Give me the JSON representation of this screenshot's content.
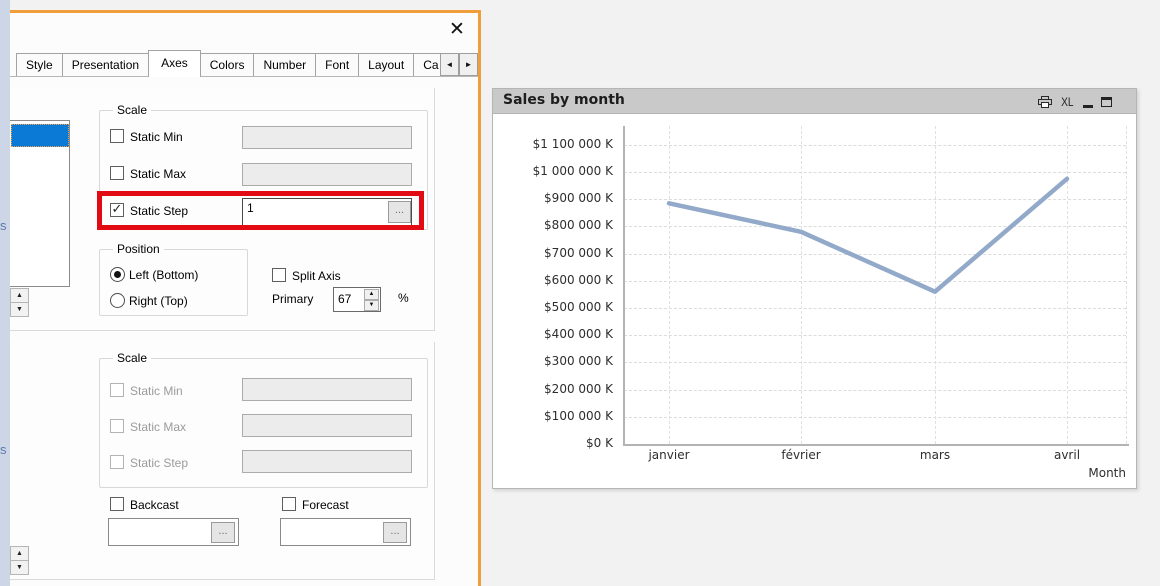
{
  "colors": {
    "dialog_accent_orange": "#ef9e3a",
    "selection_blue": "#0a7ad6",
    "highlight_red": "#e30b13",
    "line_series": "#92a9c9"
  },
  "icons": {
    "close": "✕",
    "checkmark": "✓",
    "spinner_up": "▲",
    "spinner_down": "▼",
    "tab_scroll_left": "◄",
    "tab_scroll_right": "►",
    "ellipsis": "...",
    "excel_label": "XL"
  },
  "edge_fragments": {
    "top": "s",
    "bottom": "s"
  },
  "dialog": {
    "tabs": [
      "Style",
      "Presentation",
      "Axes",
      "Colors",
      "Number",
      "Font",
      "Layout",
      "Ca"
    ],
    "selected_tab": "Axes",
    "selected_tab_index": 2,
    "scale_top": {
      "legend": "Scale",
      "static_min": "Static Min",
      "static_max": "Static Max",
      "static_step": "Static Step",
      "static_step_checked": true,
      "static_step_value": "1"
    },
    "position": {
      "legend": "Position",
      "left_bottom": "Left (Bottom)",
      "right_top": "Right (Top)",
      "selected": "Left (Bottom)",
      "split_axis": "Split Axis",
      "primary_label": "Primary",
      "primary_value": "67",
      "percent": "%"
    },
    "scale_bottom": {
      "legend": "Scale",
      "static_min": "Static Min",
      "static_max": "Static Max",
      "static_step": "Static Step",
      "enabled": false
    },
    "backcast_label": "Backcast",
    "forecast_label": "Forecast"
  },
  "chart_window": {
    "title": "Sales by month"
  },
  "chart_data": {
    "type": "line",
    "title": "Sales by month",
    "categories": [
      "janvier",
      "février",
      "mars",
      "avril"
    ],
    "values": [
      885000,
      780000,
      560000,
      975000
    ],
    "xlabel": "Month",
    "ylabel": "",
    "ylim": [
      0,
      1150000
    ],
    "ytick_step": 100000,
    "yticks": [
      [
        0,
        "$0 K"
      ],
      [
        100000,
        "$100 000 K"
      ],
      [
        200000,
        "$200 000 K"
      ],
      [
        300000,
        "$300 000 K"
      ],
      [
        400000,
        "$400 000 K"
      ],
      [
        500000,
        "$500 000 K"
      ],
      [
        600000,
        "$600 000 K"
      ],
      [
        700000,
        "$700 000 K"
      ],
      [
        800000,
        "$800 000 K"
      ],
      [
        900000,
        "$900 000 K"
      ],
      [
        1000000,
        "$1 000 000 K"
      ],
      [
        1100000,
        "$1 100 000 K"
      ]
    ],
    "grid": true,
    "legend_position": "none",
    "line_color": "#92a9c9"
  }
}
